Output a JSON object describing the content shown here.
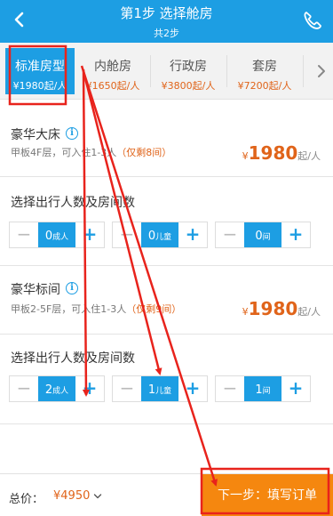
{
  "header": {
    "title": "第1步 选择舱房",
    "subtitle": "共2步"
  },
  "tabs": [
    {
      "name": "标准房型",
      "price": "¥1980起/人",
      "active": true
    },
    {
      "name": "内舱房",
      "price": "¥1650起/人",
      "active": false
    },
    {
      "name": "行政房",
      "price": "¥3800起/人",
      "active": false
    },
    {
      "name": "套房",
      "price": "¥7200起/人",
      "active": false
    }
  ],
  "rooms": [
    {
      "name": "豪华大床",
      "desc": "甲板4F层，可入住1-3人",
      "remaining": "（仅剩8间）",
      "price_currency": "¥",
      "price_value": "1980",
      "price_unit": "起/人",
      "section_title": "选择出行人数及房间数",
      "steppers": [
        {
          "value": "0",
          "unit": "成人"
        },
        {
          "value": "0",
          "unit": "儿童"
        },
        {
          "value": "0",
          "unit": "间"
        }
      ]
    },
    {
      "name": "豪华标间",
      "desc": "甲板2-5F层，可入住1-3人",
      "remaining": "（仅剩9间）",
      "price_currency": "¥",
      "price_value": "1980",
      "price_unit": "起/人",
      "section_title": "选择出行人数及房间数",
      "steppers": [
        {
          "value": "2",
          "unit": "成人"
        },
        {
          "value": "1",
          "unit": "儿童"
        },
        {
          "value": "1",
          "unit": "间"
        }
      ]
    }
  ],
  "stepper_symbols": {
    "minus": "−",
    "plus": "+"
  },
  "info_symbol": "i",
  "footer": {
    "total_label": "总价：",
    "total_value": "¥4950",
    "next_label": "下一步：填写订单"
  },
  "colors": {
    "primary": "#1d9ee3",
    "accent": "#e0641a",
    "next_button": "#f5870f",
    "annotation": "#e8231c"
  },
  "icons": {
    "back": "chevron-left-icon",
    "phone": "phone-icon",
    "tab_more": "chevron-right-icon",
    "info": "info-icon",
    "total_expand": "chevron-down-icon"
  }
}
